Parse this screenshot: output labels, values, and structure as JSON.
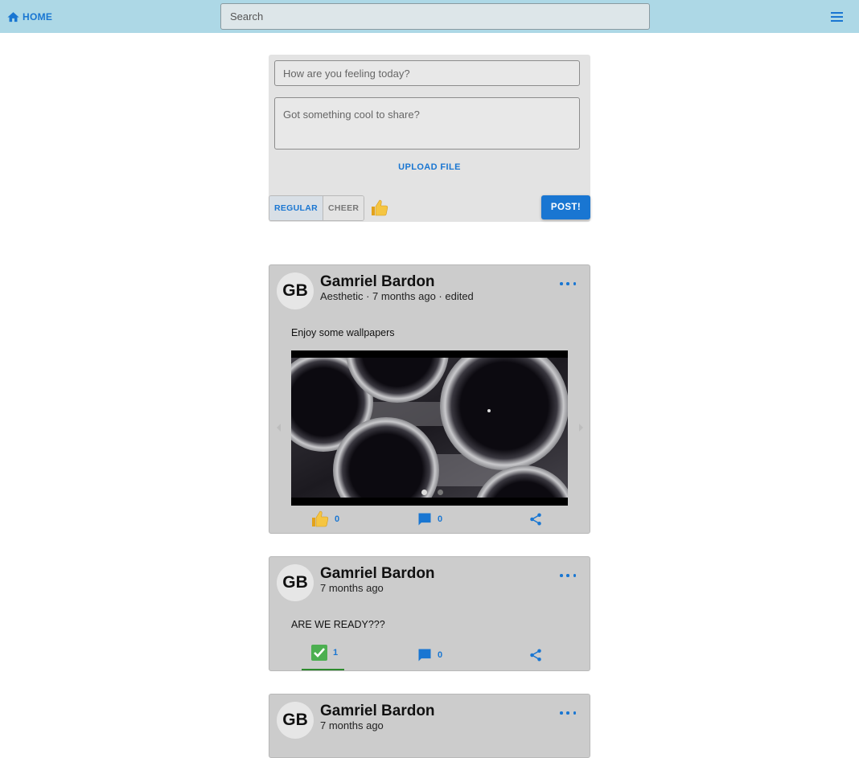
{
  "topbar": {
    "home_label": "HOME",
    "search_placeholder": "Search",
    "brand_color": "#add8e6",
    "accent_color": "#1976d2"
  },
  "composer": {
    "title_placeholder": "How are you feeling today?",
    "body_placeholder": "Got something cool to share?",
    "upload_label": "UPLOAD FILE",
    "mode_options": [
      "REGULAR",
      "CHEER"
    ],
    "mode_selected": "REGULAR",
    "post_label": "POST!"
  },
  "posts": [
    {
      "avatar_initials": "GB",
      "author": "Gamriel Bardon",
      "meta": "Aesthetic · 7 months ago · edited",
      "text": "Enjoy some wallpapers",
      "has_carousel": true,
      "carousel_slide_count": 2,
      "carousel_active_index": 0,
      "reaction_icon": "thumbs-up-icon",
      "reaction_count": "0",
      "comment_count": "0"
    },
    {
      "avatar_initials": "GB",
      "author": "Gamriel Bardon",
      "meta": "7 months ago",
      "text": "ARE WE READY???",
      "has_carousel": false,
      "reaction_icon": "check-mark-icon",
      "reaction_count": "1",
      "reaction_active": true,
      "comment_count": "0"
    },
    {
      "avatar_initials": "GB",
      "author": "Gamriel Bardon",
      "meta": "7 months ago"
    }
  ]
}
